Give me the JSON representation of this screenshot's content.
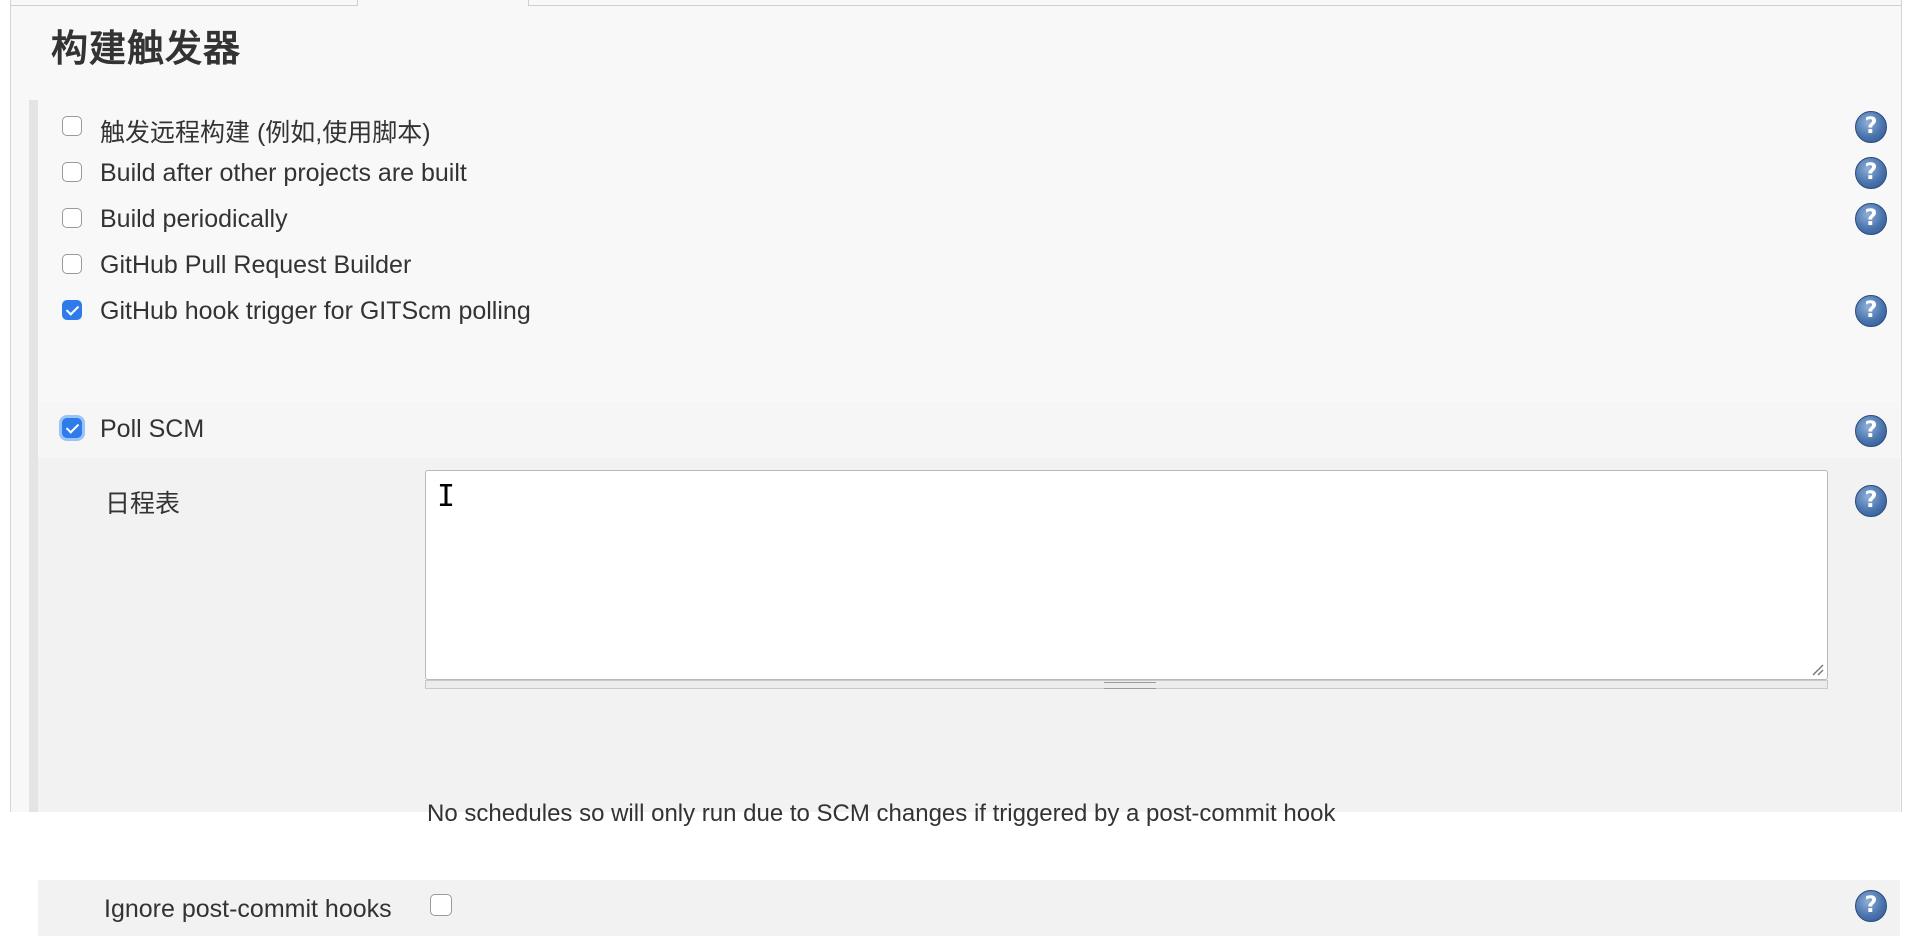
{
  "section": {
    "title": "构建触发器"
  },
  "triggers": [
    {
      "label": "触发远程构建 (例如,使用脚本)",
      "checked": false,
      "has_help": true
    },
    {
      "label": "Build after other projects are built",
      "checked": false,
      "has_help": true
    },
    {
      "label": "Build periodically",
      "checked": false,
      "has_help": true
    },
    {
      "label": "GitHub Pull Request Builder",
      "checked": false,
      "has_help": false
    },
    {
      "label": "GitHub hook trigger for GITScm polling",
      "checked": true,
      "has_help": true
    }
  ],
  "poll_scm": {
    "label": "Poll SCM",
    "checked": true,
    "schedule_label": "日程表",
    "schedule_value": "",
    "schedule_note": "No schedules so will only run due to SCM changes if triggered by a post-commit hook",
    "ignore_label": "Ignore post-commit hooks",
    "ignore_checked": false
  },
  "help_icon_glyph": "?",
  "colors": {
    "accent": "#2e7bea",
    "help_icon": "#4a74ad",
    "panel_bg": "#f8f8f8"
  }
}
